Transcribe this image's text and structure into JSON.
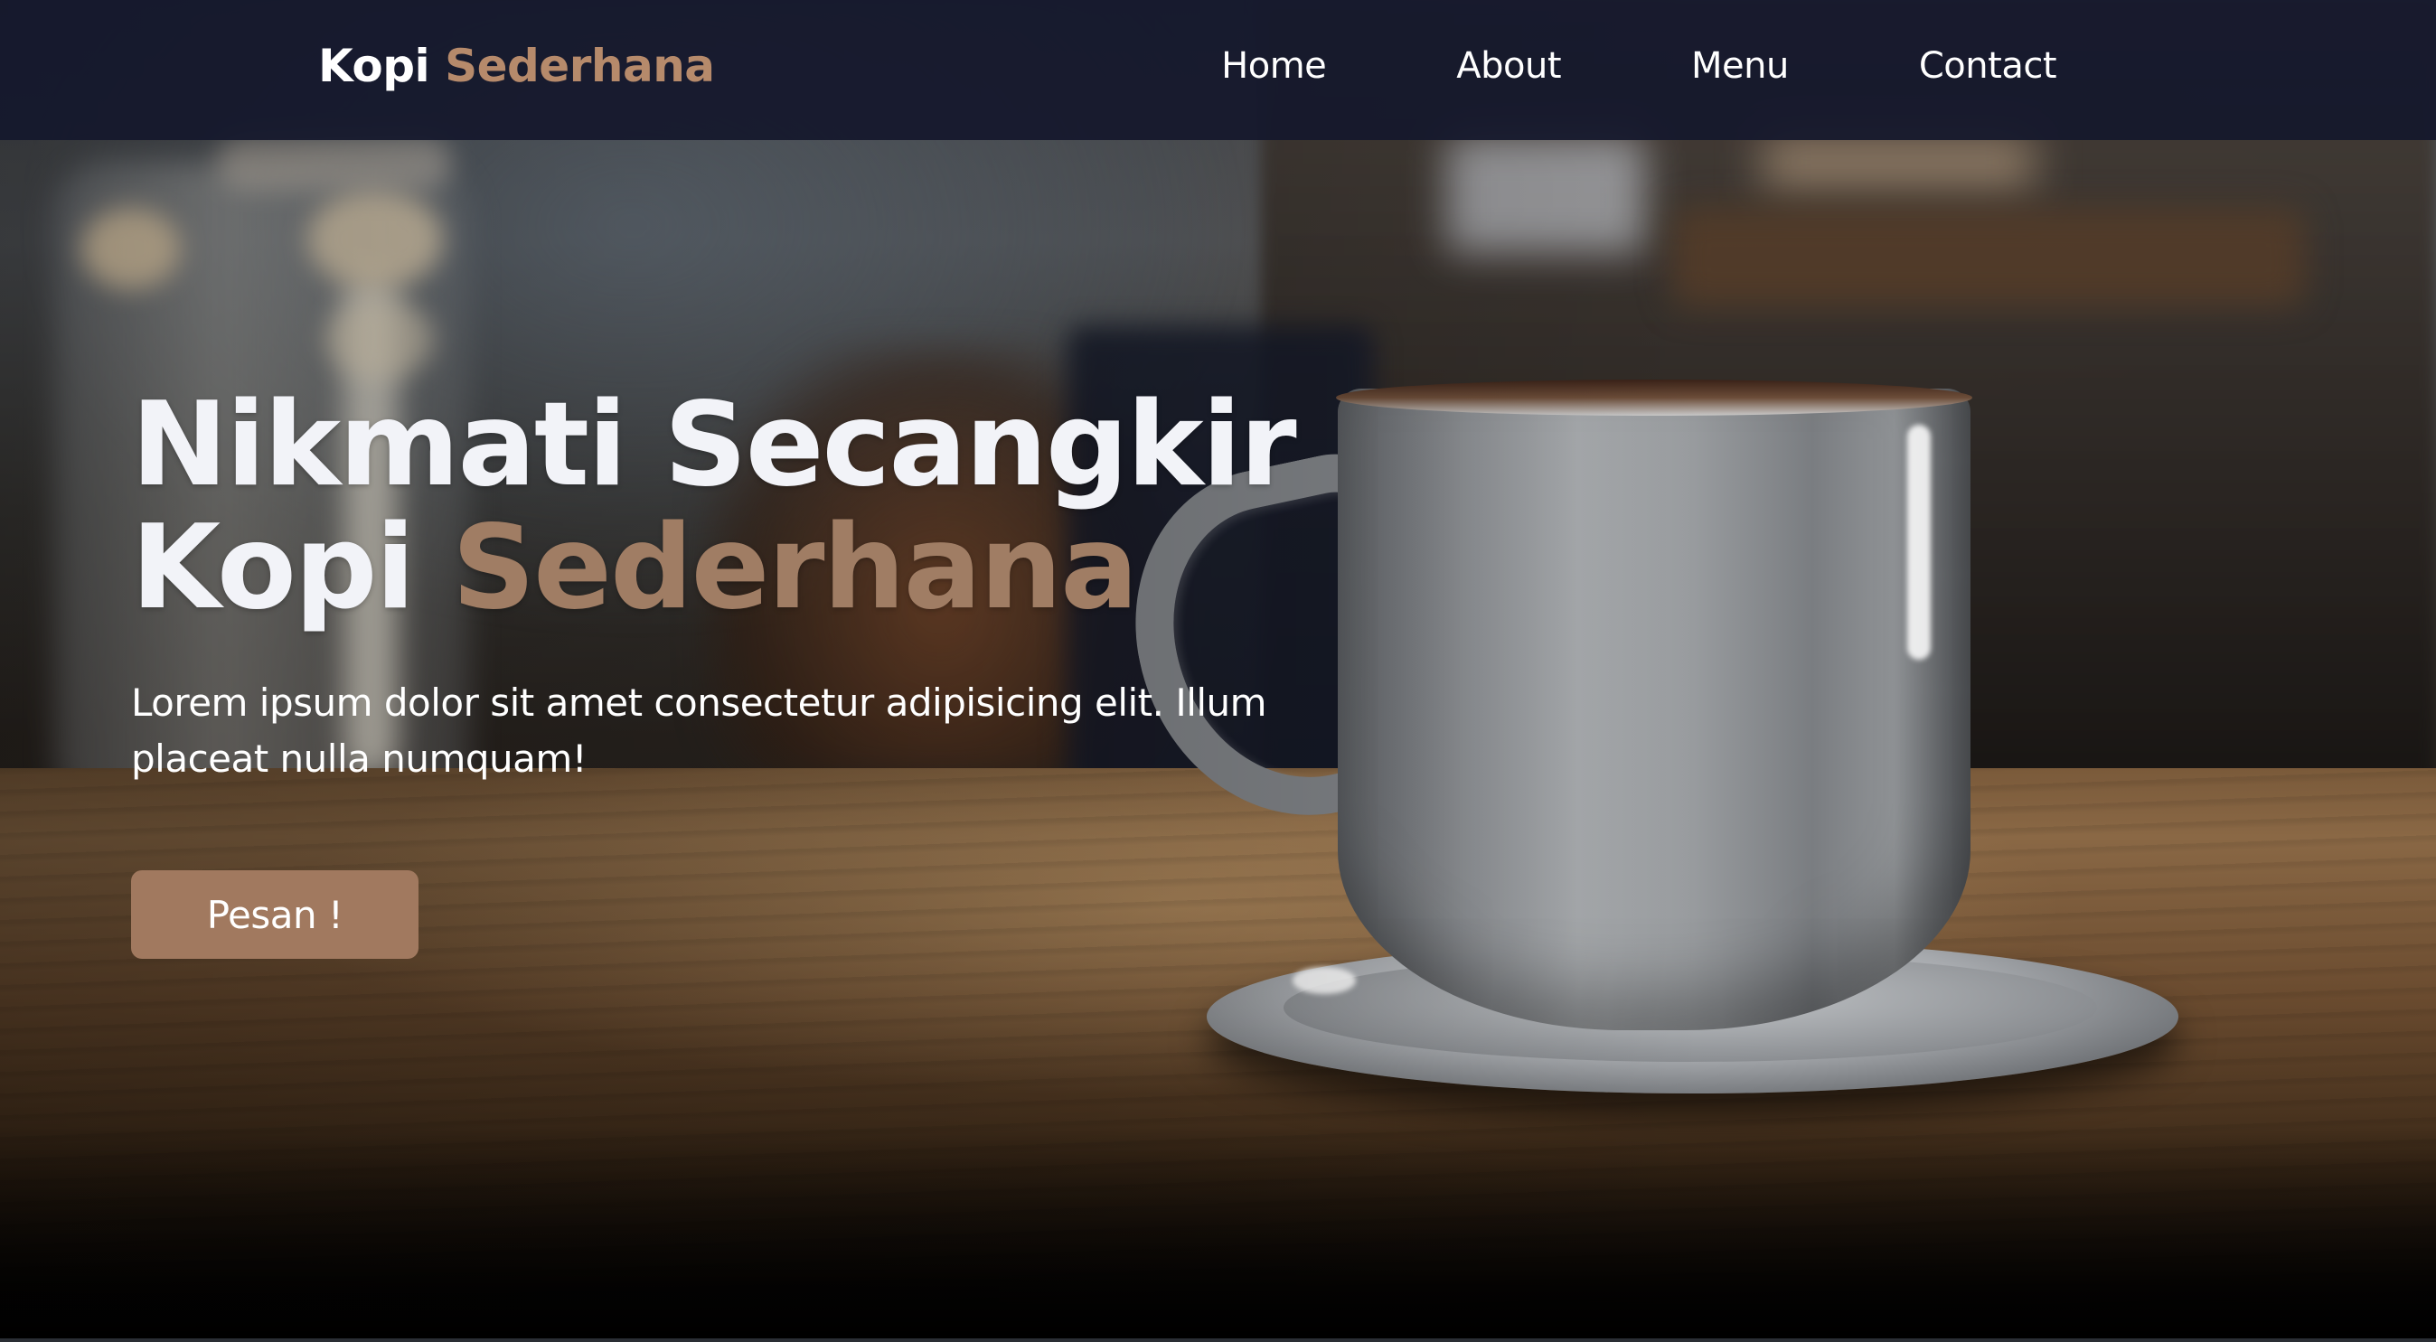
{
  "navbar": {
    "brand_primary": "Kopi",
    "brand_accent": "Sederhana",
    "links": [
      {
        "label": "Home"
      },
      {
        "label": "About"
      },
      {
        "label": "Menu"
      },
      {
        "label": "Contact"
      }
    ]
  },
  "hero": {
    "title_line1": "Nikmati Secangkir",
    "title_line2_primary": "Kopi",
    "title_line2_accent": "Sederhana",
    "description": "Lorem ipsum dolor sit amet consectetur adipisicing elit. Illum placeat nulla numquam!",
    "cta_label": "Pesan !",
    "background_image": "coffee-cup-on-wooden-table"
  },
  "colors": {
    "navbar_bg": "#14182c",
    "accent": "#a07d64",
    "cta_bg": "#a1795f",
    "text": "#ffffff"
  }
}
